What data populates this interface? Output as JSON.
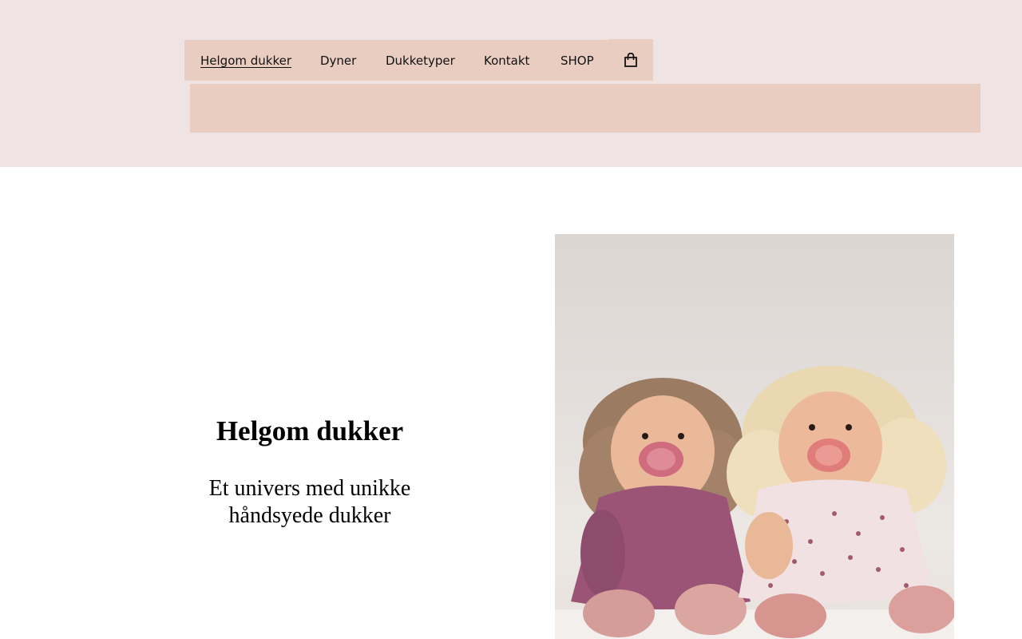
{
  "nav": {
    "items": [
      {
        "label": "Helgom dukker",
        "active": true
      },
      {
        "label": "Dyner",
        "active": false
      },
      {
        "label": "Dukketyper",
        "active": false
      },
      {
        "label": "Kontakt",
        "active": false
      },
      {
        "label": "SHOP",
        "active": false
      }
    ],
    "cart_icon": "shopping-bag-icon"
  },
  "hero": {
    "title": "Helgom dukker",
    "subtitle_line1": "Et univers med unikke",
    "subtitle_line2": "håndsyede dukker"
  },
  "colors": {
    "header_bg": "#efe4e3",
    "accent": "#eacdc1",
    "page_bg": "#ffffff"
  }
}
